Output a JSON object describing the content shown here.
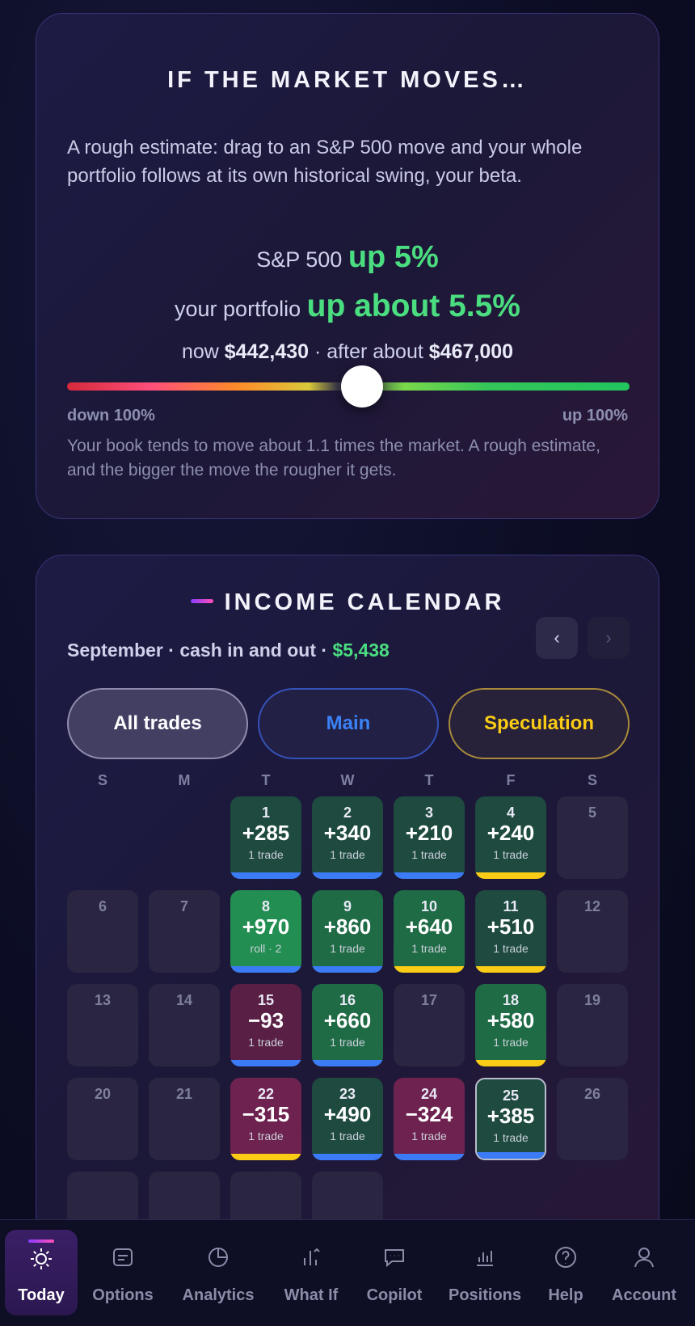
{
  "market": {
    "title": "IF THE MARKET MOVES…",
    "intro": "A rough estimate: drag to an S&P 500 move and your whole portfolio follows at its own historical swing, your beta.",
    "sp_prefix": "S&P 500",
    "sp_move": "up 5%",
    "pf_prefix": "your portfolio",
    "pf_move": "up about 5.5%",
    "now_prefix": "now",
    "now_value": "$442,430",
    "after_prefix": "· after about",
    "after_value": "$467,000",
    "slider_min_label": "down 100%",
    "slider_max_label": "up 100%",
    "slider_value": 0.05,
    "footnote": "Your book tends to move about 1.1 times the market. A rough estimate, and the bigger the move the rougher it gets."
  },
  "calendar": {
    "title": "INCOME CALENDAR",
    "summary_prefix": "September · cash in and out ·",
    "summary_amount": "$5,438",
    "prev_label": "‹",
    "next_label": "›",
    "filters": {
      "all": "All trades",
      "main": "Main",
      "spec": "Speculation"
    },
    "dow": [
      "S",
      "M",
      "T",
      "W",
      "T",
      "F",
      "S"
    ],
    "days": {
      "d1": {
        "day": "1",
        "val": "+285",
        "sub": "1 trade"
      },
      "d2": {
        "day": "2",
        "val": "+340",
        "sub": "1 trade"
      },
      "d3": {
        "day": "3",
        "val": "+210",
        "sub": "1 trade"
      },
      "d4": {
        "day": "4",
        "val": "+240",
        "sub": "1 trade"
      },
      "d5": {
        "day": "5"
      },
      "d6": {
        "day": "6"
      },
      "d7": {
        "day": "7"
      },
      "d8": {
        "day": "8",
        "val": "+970",
        "sub": "roll · 2"
      },
      "d9": {
        "day": "9",
        "val": "+860",
        "sub": "1 trade"
      },
      "d10": {
        "day": "10",
        "val": "+640",
        "sub": "1 trade"
      },
      "d11": {
        "day": "11",
        "val": "+510",
        "sub": "1 trade"
      },
      "d12": {
        "day": "12"
      },
      "d13": {
        "day": "13"
      },
      "d14": {
        "day": "14"
      },
      "d15": {
        "day": "15",
        "val": "−93",
        "sub": "1 trade"
      },
      "d16": {
        "day": "16",
        "val": "+660",
        "sub": "1 trade"
      },
      "d17": {
        "day": "17"
      },
      "d18": {
        "day": "18",
        "val": "+580",
        "sub": "1 trade"
      },
      "d19": {
        "day": "19"
      },
      "d20": {
        "day": "20"
      },
      "d21": {
        "day": "21"
      },
      "d22": {
        "day": "22",
        "val": "−315",
        "sub": "1 trade"
      },
      "d23": {
        "day": "23",
        "val": "+490",
        "sub": "1 trade"
      },
      "d24": {
        "day": "24",
        "val": "−324",
        "sub": "1 trade"
      },
      "d25": {
        "day": "25",
        "val": "+385",
        "sub": "1 trade"
      },
      "d26": {
        "day": "26"
      }
    }
  },
  "tabs": {
    "today": "Today",
    "options": "Options",
    "analytics": "Analytics",
    "whatif": "What If",
    "copilot": "Copilot",
    "positions": "Positions",
    "help": "Help",
    "account": "Account"
  }
}
